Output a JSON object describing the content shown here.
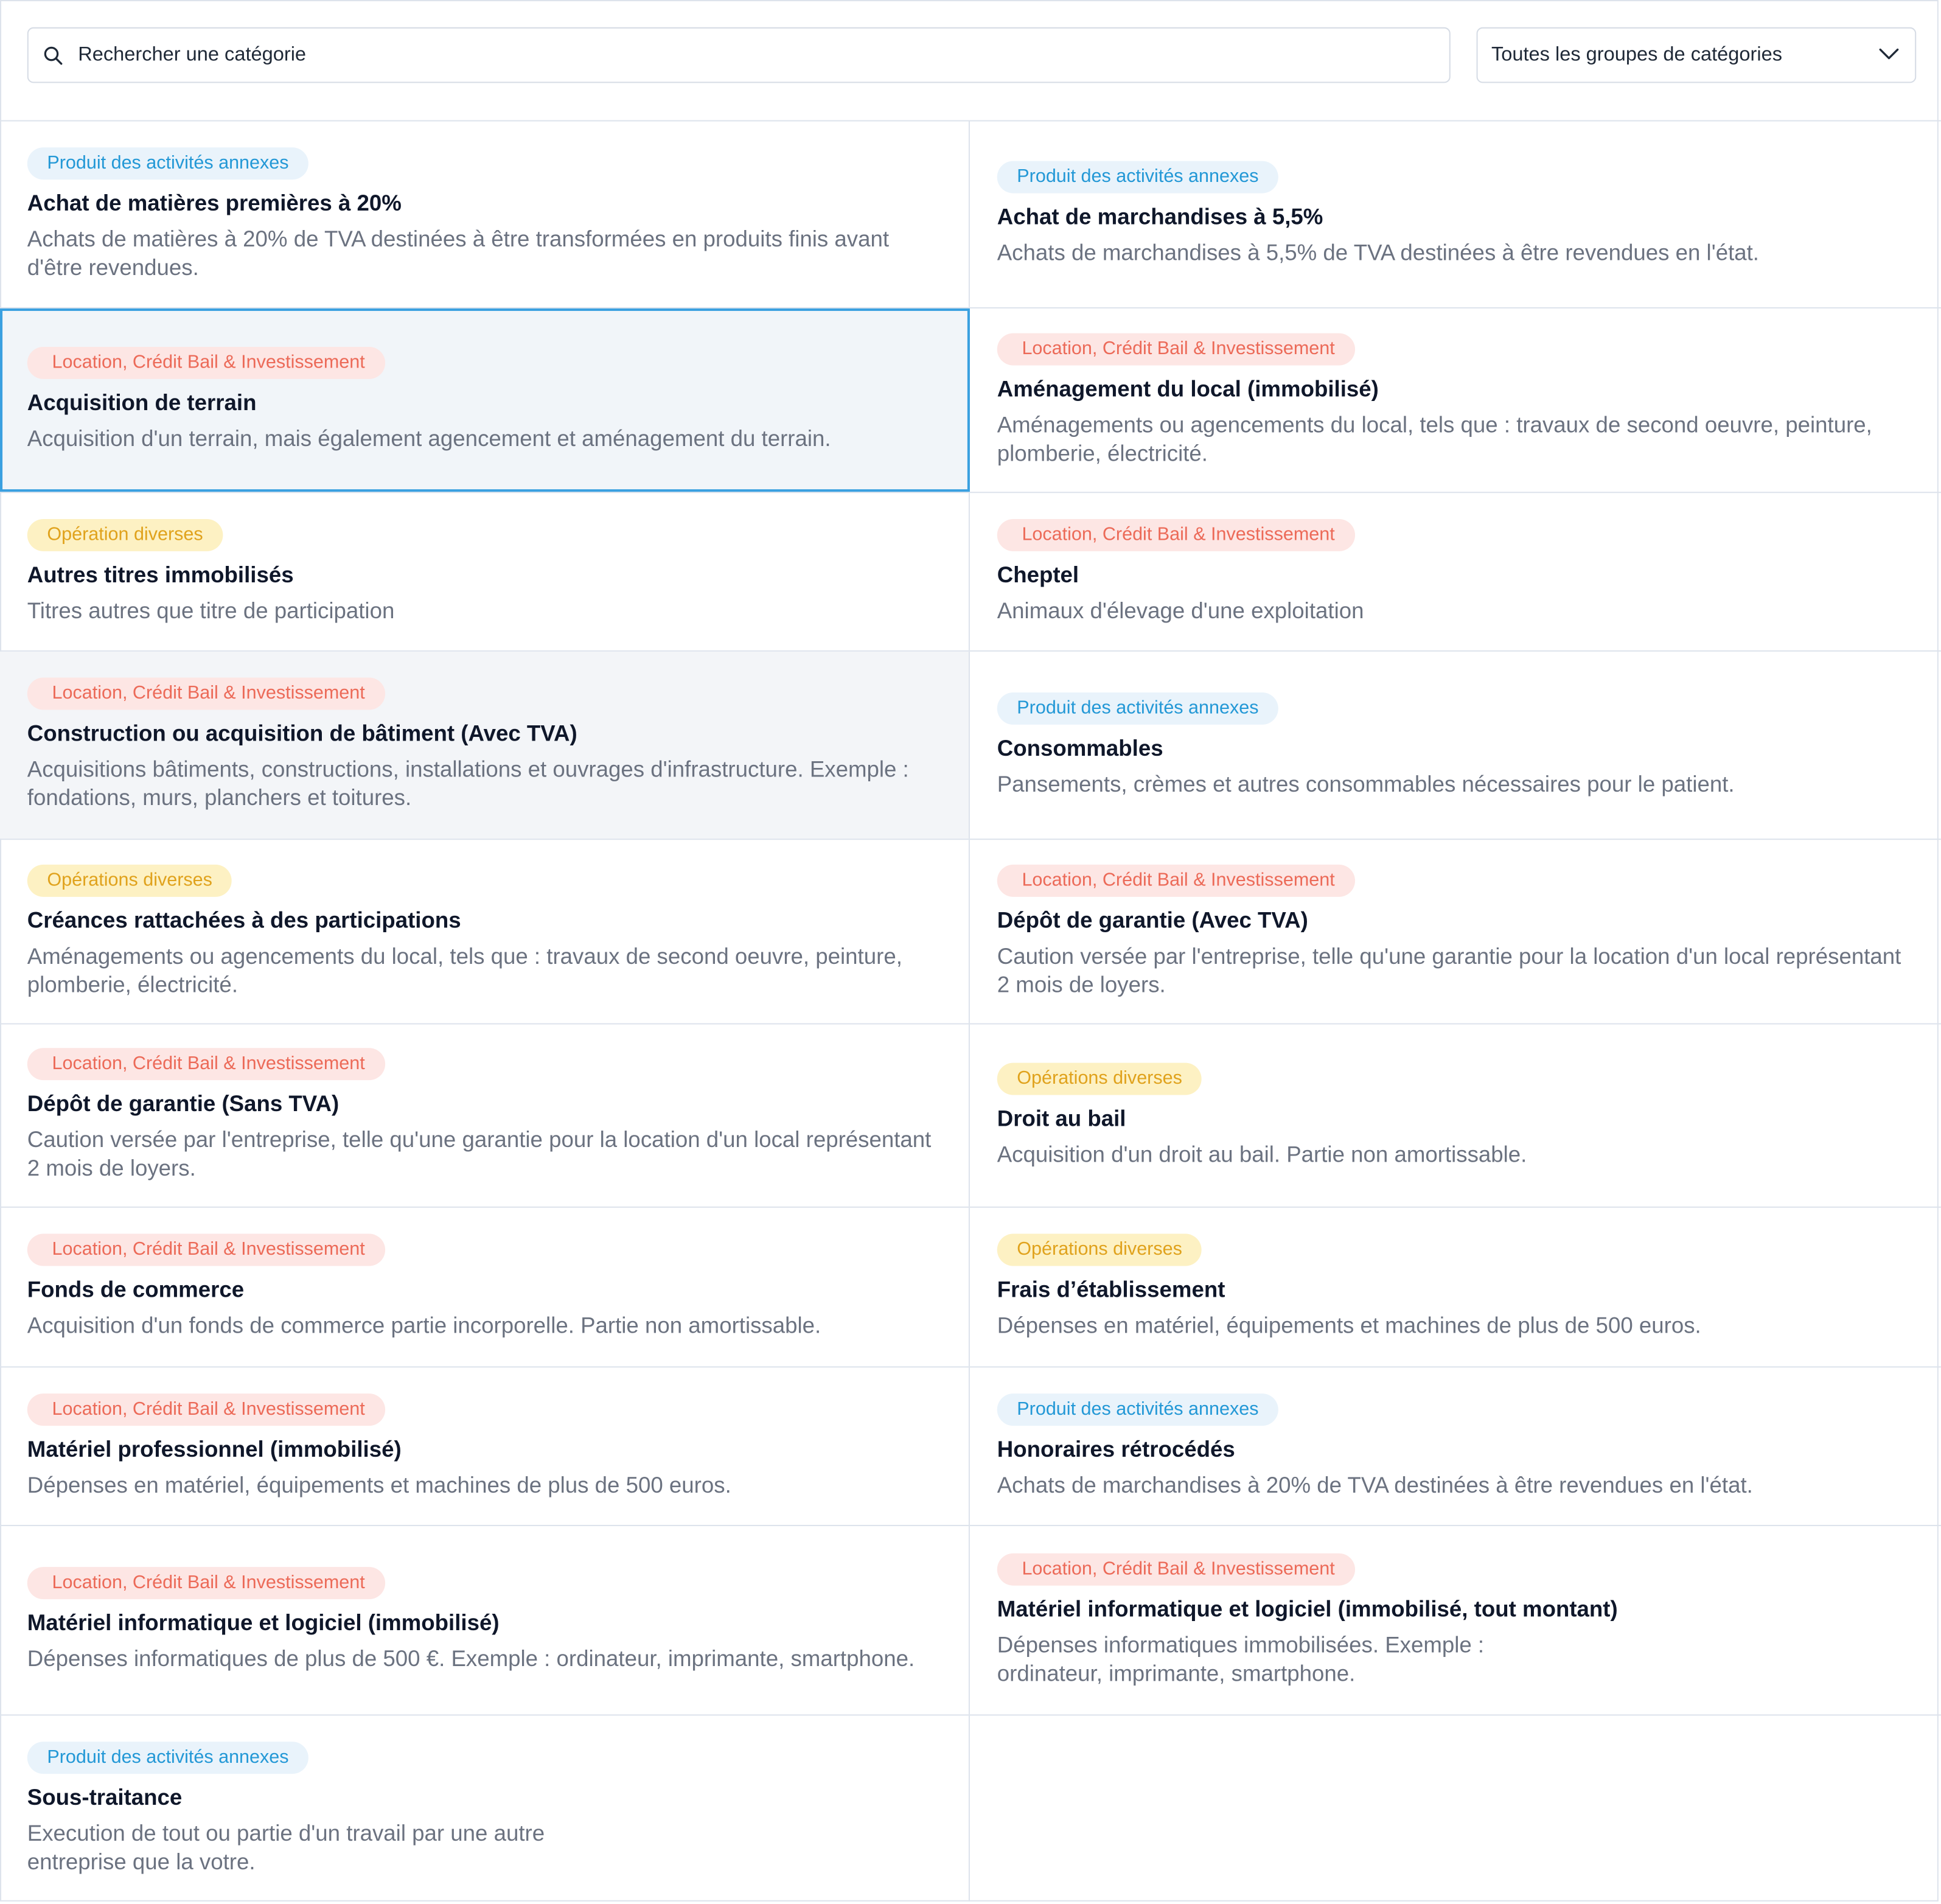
{
  "search": {
    "placeholder": "Rechercher une catégorie"
  },
  "group_filter": {
    "selected": "Toutes les groupes de catégories"
  },
  "colors": {
    "blue": "#2398d6",
    "red": "#ec6a58",
    "yellow": "#e0a21c",
    "selected_border": "#3aa0e0"
  },
  "categories": [
    {
      "group": "Produit des activités annexes",
      "color": "blue",
      "title": "Achat de matières premières à 20%",
      "description": "Achats de matières à 20% de TVA destinées à être transformées en produits finis avant d'être revendues."
    },
    {
      "group": "Produit des activités annexes",
      "color": "blue",
      "title": "Achat de marchandises à 5,5%",
      "description": "Achats de marchandises à 5,5% de TVA destinées à être revendues en l'état."
    },
    {
      "group": "Location, Crédit Bail & Investissement",
      "color": "red",
      "title": "Acquisition de terrain",
      "description": "Acquisition d'un terrain, mais également agencement et aménagement du terrain.",
      "selected": true
    },
    {
      "group": "Location, Crédit Bail & Investissement",
      "color": "red",
      "title": "Aménagement du local (immobilisé)",
      "description": "Aménagements ou agencements du local, tels que : travaux de second oeuvre, peinture, plomberie, électricité."
    },
    {
      "group": "Opération diverses",
      "color": "yellow",
      "title": "Autres titres immobilisés",
      "description": "Titres autres que titre de participation"
    },
    {
      "group": "Location, Crédit Bail & Investissement",
      "color": "red",
      "title": "Cheptel",
      "description": "Animaux d'élevage d'une exploitation"
    },
    {
      "group": "Location, Crédit Bail & Investissement",
      "color": "red",
      "title": "Construction ou acquisition de bâtiment (Avec TVA)",
      "description": "Acquisitions bâtiments, constructions, installations et ouvrages d'infrastructure. Exemple : fondations, murs, planchers et toitures.",
      "hover": true
    },
    {
      "group": "Produit des activités annexes",
      "color": "blue",
      "title": "Consommables",
      "description": "Pansements, crèmes et autres consommables nécessaires pour le patient."
    },
    {
      "group": "Opérations diverses",
      "color": "yellow",
      "title": "Créances rattachées à des participations",
      "description": "Aménagements ou agencements du local, tels que : travaux de second oeuvre, peinture, plomberie, électricité."
    },
    {
      "group": "Location, Crédit Bail & Investissement",
      "color": "red",
      "title": "Dépôt de garantie (Avec TVA)",
      "description": "Caution versée par l'entreprise, telle qu'une garantie pour la location d'un local représentant 2 mois de loyers."
    },
    {
      "group": "Location, Crédit Bail & Investissement",
      "color": "red",
      "title": "Dépôt de garantie (Sans TVA)",
      "description": "Caution versée par l'entreprise, telle qu'une garantie pour la location d'un local représentant 2 mois de loyers."
    },
    {
      "group": "Opérations diverses",
      "color": "yellow",
      "title": "Droit au bail",
      "description": "Acquisition d'un droit au bail. Partie non amortissable."
    },
    {
      "group": "Location, Crédit Bail & Investissement",
      "color": "red",
      "title": "Fonds de commerce",
      "description": "Acquisition d'un fonds de commerce partie incorporelle. Partie non amortissable."
    },
    {
      "group": "Opérations diverses",
      "color": "yellow",
      "title": "Frais d’établissement",
      "description": "Dépenses en matériel, équipements et machines de plus de 500 euros."
    },
    {
      "group": "Location, Crédit Bail & Investissement",
      "color": "red",
      "title": "Matériel professionnel (immobilisé)",
      "description": "Dépenses en matériel, équipements et machines de plus de 500 euros."
    },
    {
      "group": "Produit des activités annexes",
      "color": "blue",
      "title": "Honoraires rétrocédés",
      "description": "Achats de marchandises à 20% de TVA destinées à être revendues en l'état."
    },
    {
      "group": "Location, Crédit Bail & Investissement",
      "color": "red",
      "title": "Matériel informatique et logiciel (immobilisé)",
      "description": "Dépenses informatiques de plus de 500 €. Exemple : ordinateur, imprimante, smartphone."
    },
    {
      "group": "Location, Crédit Bail & Investissement",
      "color": "red",
      "title": "Matériel informatique et logiciel (immobilisé, tout montant)",
      "description": "Dépenses informatiques immobilisées. Exemple : ordinateur, imprimante, smartphone."
    },
    {
      "group": "Produit des activités annexes",
      "color": "blue",
      "title": "Sous-traitance",
      "description": "Execution de tout ou partie d'un travail par une autre entreprise que la votre."
    }
  ]
}
